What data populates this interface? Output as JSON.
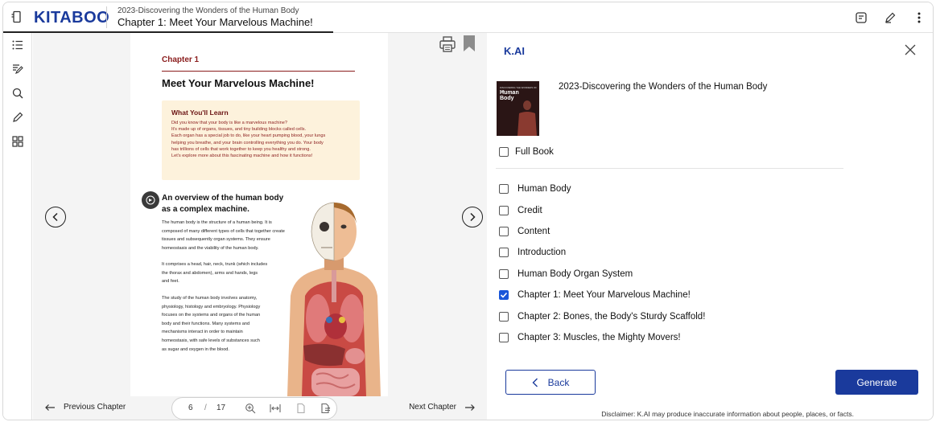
{
  "header": {
    "logo": "KITABOO",
    "book_title": "2023-Discovering the Wonders of the Human Body",
    "chapter_title": "Chapter 1: Meet Your Marvelous Machine!"
  },
  "page": {
    "chapter_label": "Chapter 1",
    "title": "Meet Your Marvelous Machine!",
    "learn_heading": "What You'll Learn",
    "learn_lines": [
      "Did you know that your body is like a marvelous machine?",
      "It's made up of organs, tissues, and tiny building blocks called cells.",
      "Each organ has a special job to do, like your heart pumping blood, your lungs",
      "helping you breathe, and your brain controlling everything you do. Your body",
      "has trillions of cells that work together to keep you healthy and strong.",
      "Let's explore more about this fascinating machine and how it functions!"
    ],
    "overview_title_1": "An overview of the human body",
    "overview_title_2": "as a complex machine.",
    "para1": [
      "The human body is the structure of a human being. It is",
      "composed of many different types of cells that together create",
      "tissues and subsequently organ systems. They ensure",
      "homeostasis and the viability of the human body."
    ],
    "para2": [
      "It comprises a head, hair, neck, trunk (which includes",
      "the thorax and abdomen), arms and hands, legs",
      "and feet."
    ],
    "para3": [
      "The study of the human body involves anatomy,",
      "physiology, histology and embryology. Physiology",
      "focuses on the systems and organs of the human",
      "body and their functions. Many systems and",
      "mechanisms interact in order to maintain",
      "homeostasis, with safe levels of substances such",
      "as sugar and oxygen in the blood."
    ]
  },
  "footer": {
    "prev_label": "Previous Chapter",
    "next_label": "Next Chapter",
    "current_page": "6",
    "separator": "/",
    "total_pages": "17"
  },
  "panel": {
    "title": "K.AI",
    "book_title": "2023-Discovering the Wonders of the Human Body",
    "cover_small": "DISCOVERING THE WONDERS OF THE",
    "cover_big_1": "Human",
    "cover_big_2": "Body",
    "full_book_label": "Full Book",
    "items": [
      {
        "label": "Human Body",
        "checked": false
      },
      {
        "label": "Credit",
        "checked": false
      },
      {
        "label": "Content",
        "checked": false
      },
      {
        "label": "Introduction",
        "checked": false
      },
      {
        "label": "Human Body Organ System",
        "checked": false
      },
      {
        "label": "Chapter 1: Meet Your Marvelous Machine!",
        "checked": true
      },
      {
        "label": "Chapter 2: Bones, the Body's Sturdy Scaffold!",
        "checked": false
      },
      {
        "label": "Chapter 3: Muscles, the Mighty Movers!",
        "checked": false
      }
    ],
    "back_label": "Back",
    "generate_label": "Generate",
    "disclaimer": "Disclaimer: K.AI may produce inaccurate information about people, places, or facts."
  },
  "colors": {
    "brand": "#1a3a9c",
    "chapter_red": "#8a1c1c",
    "learn_bg": "#fdf2dc",
    "checkbox_on": "#1a56d9"
  }
}
